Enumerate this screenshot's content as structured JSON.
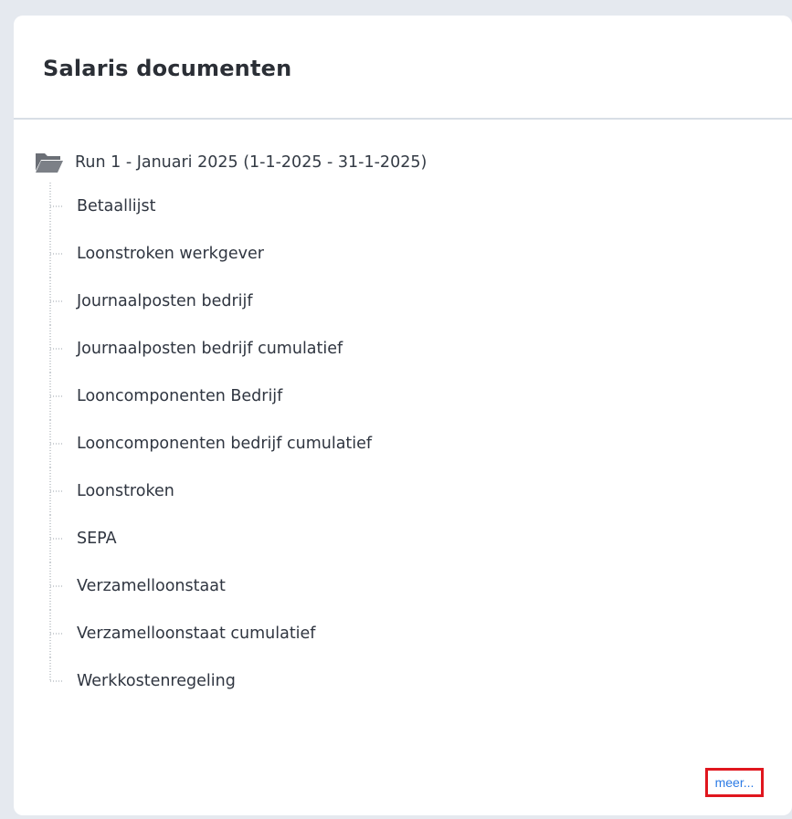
{
  "panel": {
    "title": "Salaris documenten"
  },
  "tree": {
    "run_label": "Run 1 - Januari 2025 (1-1-2025 - 31-1-2025)",
    "items": [
      {
        "label": "Betaallijst"
      },
      {
        "label": "Loonstroken werkgever"
      },
      {
        "label": "Journaalposten bedrijf"
      },
      {
        "label": "Journaalposten bedrijf cumulatief"
      },
      {
        "label": "Looncomponenten Bedrijf"
      },
      {
        "label": "Looncomponenten bedrijf cumulatief"
      },
      {
        "label": "Loonstroken"
      },
      {
        "label": "SEPA"
      },
      {
        "label": "Verzamelloonstaat"
      },
      {
        "label": "Verzamelloonstaat cumulatief"
      },
      {
        "label": "Werkkostenregeling"
      }
    ]
  },
  "footer": {
    "more_label": "meer..."
  },
  "colors": {
    "background": "#e5e9ef",
    "card": "#ffffff",
    "link": "#2c7be5",
    "highlight": "#e0161e",
    "folder": "#6b6f76"
  },
  "icons": {
    "folder": "folder-open-icon"
  }
}
